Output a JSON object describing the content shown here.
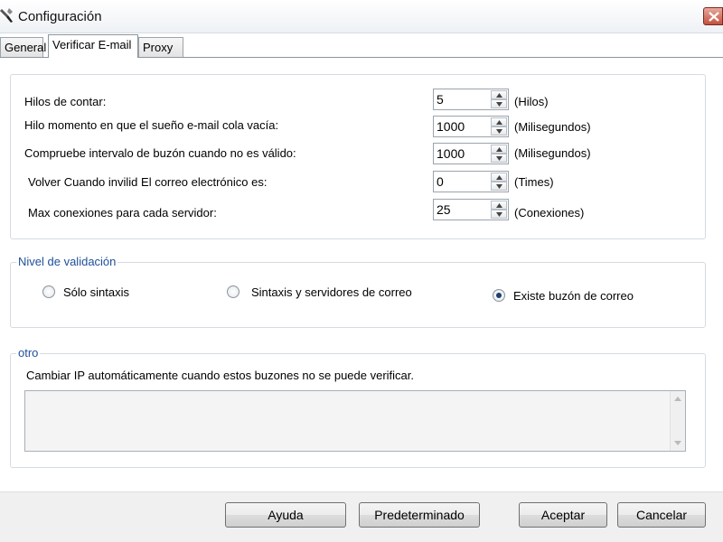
{
  "window": {
    "title": "Configuración"
  },
  "tabs": [
    {
      "label": "General"
    },
    {
      "label": "Verificar E-mail"
    },
    {
      "label": "Proxy"
    }
  ],
  "settings": [
    {
      "label": "Hilos de contar:",
      "value": "5",
      "unit": "(Hilos)"
    },
    {
      "label": "Hilo momento en que el sueño e-mail cola vacía:",
      "value": "1000",
      "unit": "(Milisegundos)"
    },
    {
      "label": "Compruebe intervalo de buzón cuando no es válido:",
      "value": "1000",
      "unit": "(Milisegundos)"
    },
    {
      "label": "Volver Cuando invilid El correo electrónico es:",
      "value": "0",
      "unit": "(Times)"
    },
    {
      "label": "Max conexiones para cada servidor:",
      "value": "25",
      "unit": "(Conexiones)"
    }
  ],
  "validation": {
    "legend": "Nivel de validación",
    "options": [
      {
        "label": "Sólo sintaxis",
        "checked": false
      },
      {
        "label": "Sintaxis y servidores de correo",
        "checked": false
      },
      {
        "label": "Existe buzón de correo",
        "checked": true
      }
    ]
  },
  "other": {
    "legend": "otro",
    "description": "Cambiar IP automáticamente cuando estos buzones no se puede verificar.",
    "text_value": ""
  },
  "buttons": {
    "help": "Ayuda",
    "default": "Predeterminado",
    "accept": "Aceptar",
    "cancel": "Cancelar"
  },
  "colors": {
    "legend_text": "#1f4f9a",
    "close_button": "#c4513e",
    "radio_selected": "#1d3f6e"
  }
}
